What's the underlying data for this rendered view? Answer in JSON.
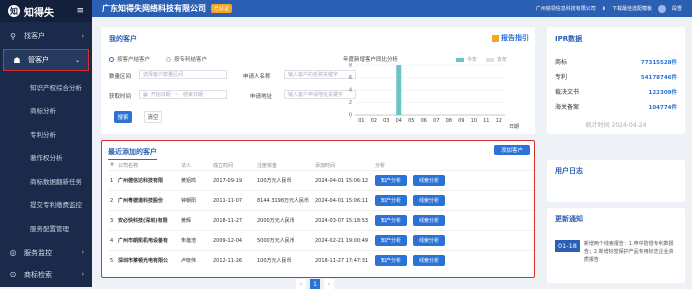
{
  "app": {
    "logo_text": "知得失",
    "logo_mark": "知",
    "menu_icon": "hamburger-icon"
  },
  "sidebar": {
    "items": [
      {
        "label": "找客户"
      },
      {
        "label": "管客户"
      }
    ],
    "sub_items": [
      "知识产权综合分析",
      "商标分析",
      "专利分析",
      "著作权分析",
      "商标数据翻新任务",
      "提交专利缴费监控",
      "服务配置管理"
    ],
    "bottom_items": [
      {
        "label": "服务监控"
      },
      {
        "label": "商标检索"
      }
    ]
  },
  "header": {
    "company": "广东知得失网络科技有限公司",
    "badge": "已认证",
    "user_company": "广州铭领信息科技有限公司",
    "download": "下载最佳选配模板",
    "username": "段雪"
  },
  "my_customers": {
    "title": "我的客户",
    "report_link": "报告指引",
    "radio_all": "按客户结客户",
    "radio_mine": "按专利结客户",
    "fields": {
      "range_label": "数量区间",
      "range_placeholder": "选择客户数量区间",
      "applicant_label": "申请人名称",
      "applicant_placeholder": "输入客户的名称关键字",
      "date_label": "获取时间",
      "date_start": "开始日期",
      "date_sep": "~",
      "date_end": "结束日期",
      "address_label": "申请地址",
      "address_placeholder": "输入客户申请地址关键字"
    },
    "search_btn": "搜索",
    "clear_btn": "清空"
  },
  "chart_data": {
    "type": "bar",
    "title": "年度新增客户同比分析",
    "legend": [
      "今年",
      "去年"
    ],
    "categories": [
      "01",
      "02",
      "03",
      "04",
      "05",
      "06",
      "07",
      "08",
      "09",
      "10",
      "11",
      "12"
    ],
    "series": [
      {
        "name": "今年",
        "values": [
          0,
          0,
          0,
          8,
          0,
          0,
          0,
          0,
          0,
          0,
          0,
          0
        ]
      },
      {
        "name": "去年",
        "values": [
          0,
          0,
          0,
          0,
          0,
          0,
          0,
          0,
          0,
          0,
          0,
          0
        ]
      }
    ],
    "y_ticks": [
      "0",
      "2",
      "4",
      "6",
      "8"
    ],
    "ylim": [
      0,
      8
    ],
    "xlabel": "日期",
    "colors": {
      "this_year": "#69c4c9",
      "last_year": "#e0e0e0"
    }
  },
  "recent": {
    "title": "最近添加的客户",
    "add_btn": "添加客户",
    "headers": [
      "#",
      "公司名称",
      "法人",
      "成立时间",
      "注册资金",
      "添加时间",
      "分析"
    ],
    "rows": [
      {
        "no": "1",
        "name": "广州德信达科技有限",
        "person": "黄铝鸣",
        "date": "2017-09-19",
        "capital": "100万元人民币",
        "added": "2024-04-01 15:06:12"
      },
      {
        "no": "2",
        "name": "广州粤德道科技股份",
        "person": "钟朝阳",
        "date": "2011-11-07",
        "capital": "8144.3198万元人民币",
        "added": "2024-04-01 15:06:11"
      },
      {
        "no": "3",
        "name": "安必快科技(深圳)有限",
        "person": "黄辉",
        "date": "2018-11-27",
        "capital": "2000万元人民币",
        "added": "2024-03-07 15:18:53"
      },
      {
        "no": "4",
        "name": "广州市朗凯机电设备有",
        "person": "朱蓓浩",
        "date": "2009-12-04",
        "capital": "5000万元人民币",
        "added": "2024-02-21 19:00:49"
      },
      {
        "no": "5",
        "name": "深圳市莱顿光电有限公",
        "person": "卢晓伟",
        "date": "2012-11-26",
        "capital": "100万元人民币",
        "added": "2018-11-27 17:47:31"
      }
    ],
    "patent_btn": "知产分析",
    "clue_btn": "线索分析",
    "page": "1"
  },
  "ipr": {
    "title": "IPR数据",
    "stats": [
      {
        "label": "商标",
        "value": "77315528件"
      },
      {
        "label": "专利",
        "value": "54178746件"
      },
      {
        "label": "裁决文书",
        "value": "122309件"
      },
      {
        "label": "海关备案",
        "value": "104774件"
      }
    ],
    "as_of": "统计时间 2024-04-24"
  },
  "user_log": {
    "title": "用户日志"
  },
  "notice": {
    "title": "更新通知",
    "date": "01-18",
    "text": "新增两个线索报告：1.申中防侵专利数报告；2.新增标签保护产品专用标志企业资质报告"
  }
}
